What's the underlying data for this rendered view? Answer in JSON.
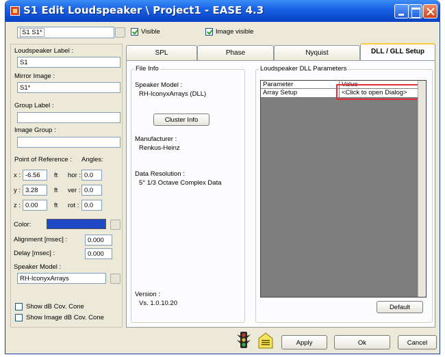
{
  "window": {
    "title": "S1 Edit Loudspeaker \\ Project1 - EASE 4.3"
  },
  "toolbar": {
    "selector_value": "S1 S1*",
    "visible_label": "Visible",
    "visible_checked": true,
    "image_visible_label": "Image visible",
    "image_visible_checked": true
  },
  "left": {
    "loudspeaker_label": {
      "label": "Loudspeaker Label :",
      "value": "S1"
    },
    "mirror_image": {
      "label": "Mirror Image :",
      "value": "S1*"
    },
    "group_label": {
      "label": "Group Label :",
      "value": ""
    },
    "image_group": {
      "label": "Image Group :",
      "value": ""
    },
    "reference_header": "Point of Reference :",
    "angles_header": "Angles:",
    "x": {
      "label": "x :",
      "value": "-6.56",
      "unit": "ft",
      "angle_label": "hor :",
      "angle_value": "0.0"
    },
    "y": {
      "label": "y :",
      "value": "3.28",
      "unit": "ft",
      "angle_label": "ver :",
      "angle_value": "0.0"
    },
    "z": {
      "label": "z :",
      "value": "0.00",
      "unit": "ft",
      "angle_label": "rot :",
      "angle_value": "0.0"
    },
    "color_label": "Color:",
    "color_value": "#1f48c6",
    "alignment": {
      "label": "Alignment [msec] :",
      "value": "0.000"
    },
    "delay": {
      "label": "Delay [msec] :",
      "value": "0.000"
    },
    "speaker_model": {
      "label": "Speaker Model :",
      "value": "RH-IconyxArrays"
    },
    "show_cov_cone": "Show dB Cov. Cone",
    "show_image_cov_cone": "Show Image dB Cov. Cone"
  },
  "tabs": [
    {
      "label": "SPL",
      "active": false
    },
    {
      "label": "Phase",
      "active": false
    },
    {
      "label": "Nyquist",
      "active": false
    },
    {
      "label": "DLL / GLL Setup",
      "active": true
    }
  ],
  "file_info": {
    "title": "File Info",
    "speaker_model_label": "Speaker Model :",
    "speaker_model_value": "RH-IconyxArrays (DLL)",
    "cluster_info_button": "Cluster Info",
    "manufacturer_label": "Manufacturer :",
    "manufacturer_value": "Renkus-Heinz",
    "data_resolution_label": "Data Resolution :",
    "data_resolution_value": "5° 1/3 Octave Complex Data",
    "version_label": "Version :",
    "version_value": "Vs. 1.0.10.20"
  },
  "dll_params": {
    "title": "Loudspeaker DLL Parameters",
    "columns": [
      "Parameter",
      "Value"
    ],
    "rows": [
      {
        "parameter": "Array Setup",
        "value": "<Click to open Dialog>"
      }
    ],
    "default_button": "Default"
  },
  "footer": {
    "apply_button": "Apply",
    "ok_button": "Ok",
    "cancel_button": "Cancel"
  }
}
